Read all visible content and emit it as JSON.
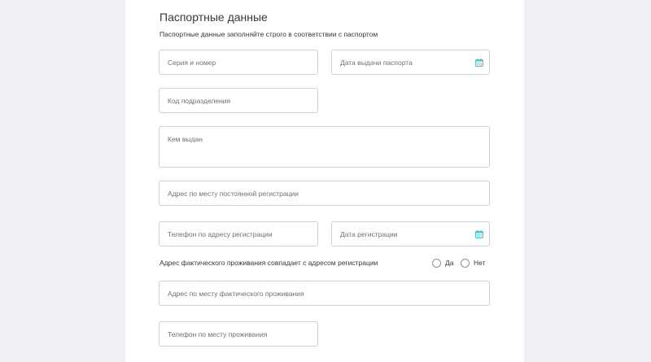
{
  "section": {
    "title": "Паспортные данные",
    "subtitle": "Паспортные данные заполняйте строго в соответствии с паспортом"
  },
  "fields": {
    "series_number": {
      "placeholder": "Серия и номер"
    },
    "issue_date": {
      "placeholder": "Дата выдачи паспорта",
      "icon": "calendar-icon"
    },
    "division_code": {
      "placeholder": "Код подразделения"
    },
    "issued_by": {
      "placeholder": "Кем выдан"
    },
    "registration_address": {
      "placeholder": "Адрес по месту постоянной регистрации"
    },
    "registration_phone": {
      "placeholder": "Телефон по адресу регистрации"
    },
    "registration_date": {
      "placeholder": "Дата регистрации",
      "icon": "calendar-icon"
    },
    "actual_address": {
      "placeholder": "Адрес по месту фактического проживания"
    },
    "residence_phone": {
      "placeholder": "Телефон по месту проживания"
    }
  },
  "same_address": {
    "question": "Адрес фактического проживания совпадает с адресом регистрации",
    "options": [
      {
        "label": "Да",
        "selected": false
      },
      {
        "label": "Нет",
        "selected": false
      }
    ]
  },
  "colors": {
    "page_background": "#eef0f3",
    "card_background": "#ffffff",
    "border": "#cdd1d6",
    "accent": "#4ec3c8"
  }
}
